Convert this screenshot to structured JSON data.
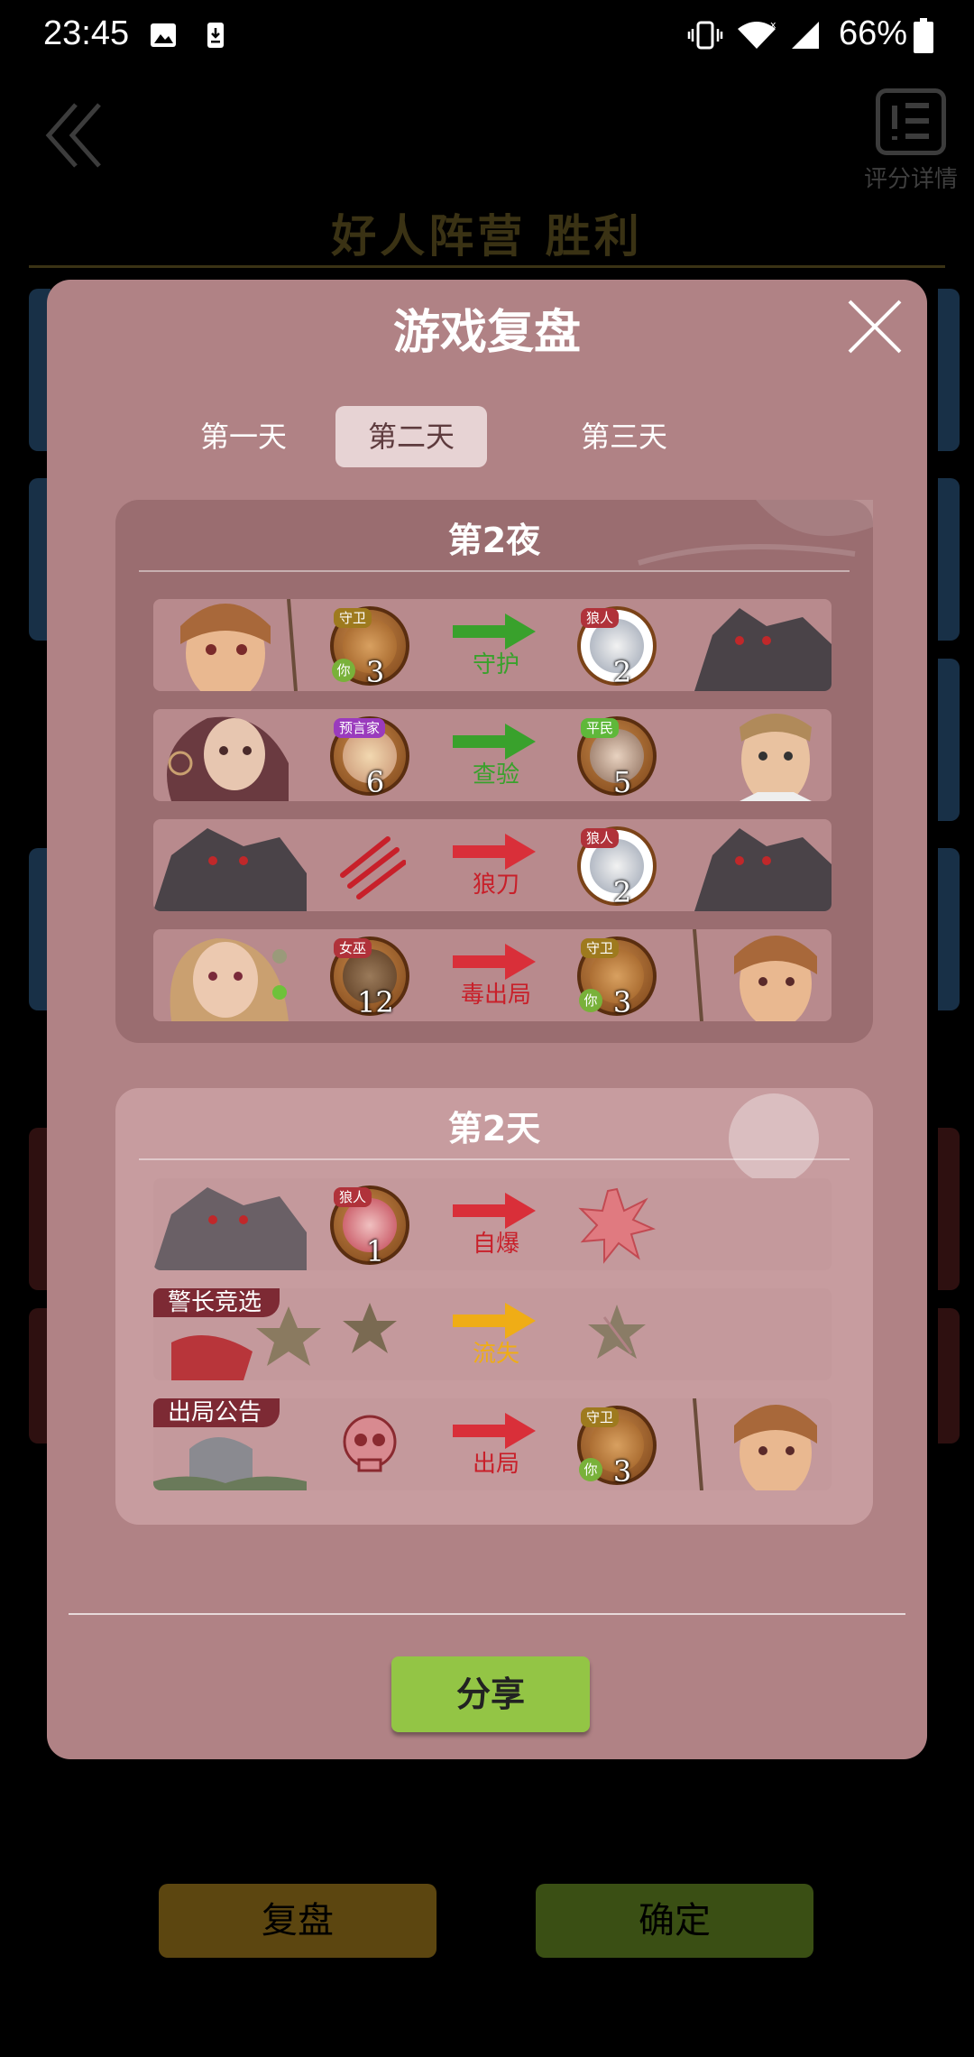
{
  "status_bar": {
    "time": "23:45",
    "battery": "66%",
    "icons": [
      "image-icon",
      "download-icon",
      "vibrate-icon",
      "wifi-icon",
      "signal-icon",
      "battery-icon"
    ]
  },
  "background_page": {
    "result_title": "好人阵营 胜利",
    "score_detail_label": "评分详情",
    "review_button": "复盘",
    "confirm_button": "确定"
  },
  "dialog": {
    "title": "游戏复盘",
    "tabs": [
      {
        "label": "第一天",
        "active": false
      },
      {
        "label": "第二天",
        "active": true
      },
      {
        "label": "第三天",
        "active": false
      }
    ],
    "night": {
      "title": "第2夜",
      "rows": [
        {
          "actor_role": "守卫",
          "actor_seat": "3",
          "actor_you": "你",
          "action": "守护",
          "target_role": "狼人",
          "target_seat": "2",
          "target_you": ""
        },
        {
          "actor_role": "预言家",
          "actor_seat": "6",
          "actor_you": "",
          "action": "查验",
          "target_role": "平民",
          "target_seat": "5",
          "target_you": ""
        },
        {
          "actor_role": "",
          "actor_seat": "",
          "actor_you": "",
          "action": "狼刀",
          "target_role": "狼人",
          "target_seat": "2",
          "target_you": ""
        },
        {
          "actor_role": "女巫",
          "actor_seat": "12",
          "actor_you": "",
          "action": "毒出局",
          "target_role": "守卫",
          "target_seat": "3",
          "target_you": "你"
        }
      ]
    },
    "day": {
      "title": "第2天",
      "rows": [
        {
          "badge": "",
          "actor_role": "狼人",
          "actor_seat": "1",
          "action": "自爆",
          "target_role": "",
          "target_seat": "",
          "target_you": ""
        },
        {
          "badge": "警长竞选",
          "actor_role": "",
          "actor_seat": "",
          "action": "流失",
          "target_role": "",
          "target_seat": "",
          "target_you": ""
        },
        {
          "badge": "出局公告",
          "actor_role": "",
          "actor_seat": "",
          "action": "出局",
          "target_role": "守卫",
          "target_seat": "3",
          "target_you": "你"
        }
      ]
    },
    "share_button": "分享"
  },
  "colors": {
    "dialog_bg": "#b08285",
    "night_section": "#9a6d70",
    "day_section": "#c79c9f",
    "green_arrow": "#39a12c",
    "red_arrow": "#d92f39",
    "gold_arrow": "#efad16",
    "share_green": "#93c545",
    "wolf_tag": "#b0323a",
    "guard_tag": "#9e7a1e",
    "seer_tag": "#9a3bbd",
    "villager_tag": "#5fb83a"
  }
}
